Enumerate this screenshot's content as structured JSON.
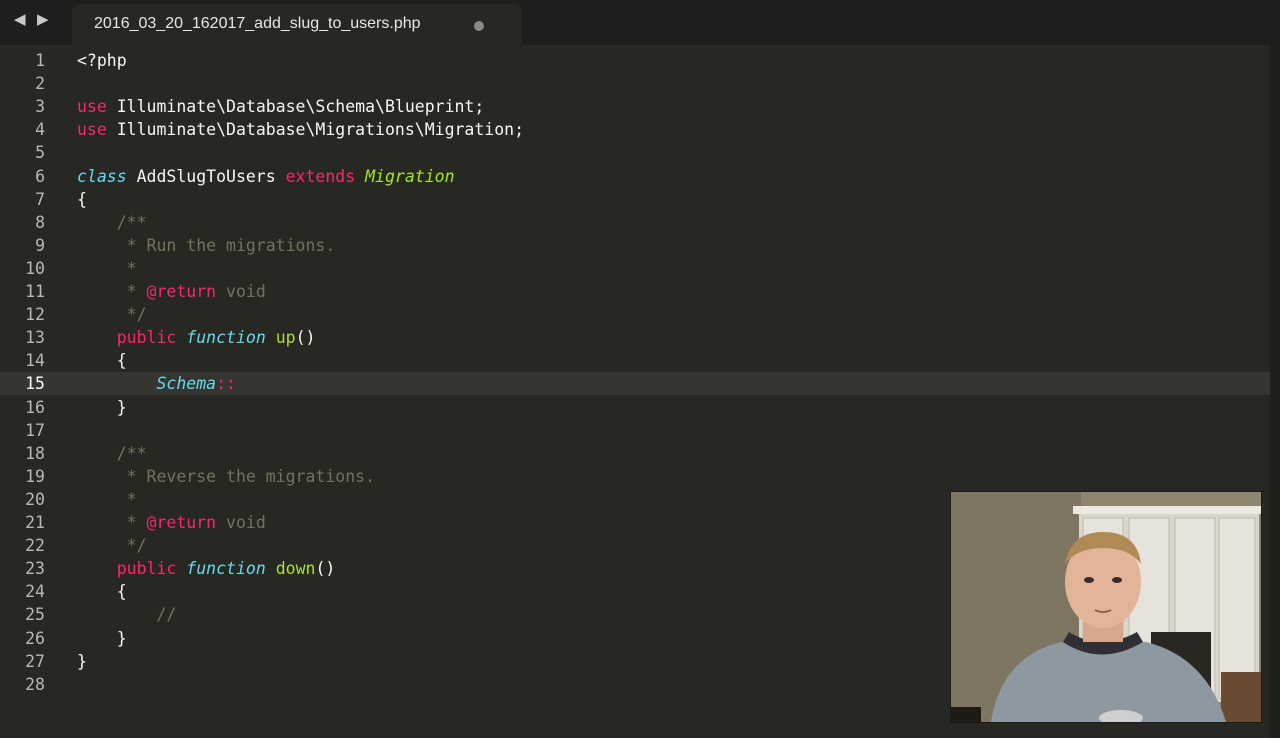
{
  "toolbar": {
    "back_icon": "left-arrow-icon",
    "forward_icon": "right-arrow-icon"
  },
  "tab": {
    "title": "2016_03_20_162017_add_slug_to_users.php",
    "modified_indicator": "dot-icon"
  },
  "editor": {
    "active_line": 15,
    "lines": [
      {
        "n": "1",
        "tokens": [
          {
            "t": "<?php",
            "c": "p"
          }
        ]
      },
      {
        "n": "2",
        "tokens": []
      },
      {
        "n": "3",
        "tokens": [
          {
            "t": "use",
            "c": "k"
          },
          {
            "t": " Illuminate\\Database\\Schema\\Blueprint;",
            "c": "p"
          }
        ]
      },
      {
        "n": "4",
        "tokens": [
          {
            "t": "use",
            "c": "k"
          },
          {
            "t": " Illuminate\\Database\\Migrations\\Migration;",
            "c": "p"
          }
        ]
      },
      {
        "n": "5",
        "tokens": []
      },
      {
        "n": "6",
        "tokens": [
          {
            "t": "class",
            "c": "s"
          },
          {
            "t": " AddSlugToUsers ",
            "c": "p"
          },
          {
            "t": "extends",
            "c": "k"
          },
          {
            "t": " ",
            "c": "p"
          },
          {
            "t": "Migration",
            "c": "ent"
          }
        ]
      },
      {
        "n": "7",
        "tokens": [
          {
            "t": "{",
            "c": "p"
          }
        ]
      },
      {
        "n": "8",
        "tokens": [
          {
            "t": "    /**",
            "c": "c"
          }
        ]
      },
      {
        "n": "9",
        "tokens": [
          {
            "t": "     * Run the migrations.",
            "c": "c"
          }
        ]
      },
      {
        "n": "10",
        "tokens": [
          {
            "t": "     *",
            "c": "c"
          }
        ]
      },
      {
        "n": "11",
        "tokens": [
          {
            "t": "     * ",
            "c": "c"
          },
          {
            "t": "@return",
            "c": "k"
          },
          {
            "t": " void",
            "c": "c"
          }
        ]
      },
      {
        "n": "12",
        "tokens": [
          {
            "t": "     */",
            "c": "c"
          }
        ]
      },
      {
        "n": "13",
        "tokens": [
          {
            "t": "    ",
            "c": "p"
          },
          {
            "t": "public",
            "c": "k"
          },
          {
            "t": " ",
            "c": "p"
          },
          {
            "t": "function",
            "c": "s"
          },
          {
            "t": " ",
            "c": "p"
          },
          {
            "t": "up",
            "c": "fn"
          },
          {
            "t": "()",
            "c": "p"
          }
        ]
      },
      {
        "n": "14",
        "tokens": [
          {
            "t": "    {",
            "c": "p"
          }
        ]
      },
      {
        "n": "15",
        "tokens": [
          {
            "t": "        ",
            "c": "p"
          },
          {
            "t": "Schema",
            "c": "s"
          },
          {
            "t": "::",
            "c": "k"
          }
        ]
      },
      {
        "n": "16",
        "tokens": [
          {
            "t": "    }",
            "c": "p"
          }
        ]
      },
      {
        "n": "17",
        "tokens": []
      },
      {
        "n": "18",
        "tokens": [
          {
            "t": "    /**",
            "c": "c"
          }
        ]
      },
      {
        "n": "19",
        "tokens": [
          {
            "t": "     * Reverse the migrations.",
            "c": "c"
          }
        ]
      },
      {
        "n": "20",
        "tokens": [
          {
            "t": "     *",
            "c": "c"
          }
        ]
      },
      {
        "n": "21",
        "tokens": [
          {
            "t": "     * ",
            "c": "c"
          },
          {
            "t": "@return",
            "c": "k"
          },
          {
            "t": " void",
            "c": "c"
          }
        ]
      },
      {
        "n": "22",
        "tokens": [
          {
            "t": "     */",
            "c": "c"
          }
        ]
      },
      {
        "n": "23",
        "tokens": [
          {
            "t": "    ",
            "c": "p"
          },
          {
            "t": "public",
            "c": "k"
          },
          {
            "t": " ",
            "c": "p"
          },
          {
            "t": "function",
            "c": "s"
          },
          {
            "t": " ",
            "c": "p"
          },
          {
            "t": "down",
            "c": "fn"
          },
          {
            "t": "()",
            "c": "p"
          }
        ]
      },
      {
        "n": "24",
        "tokens": [
          {
            "t": "    {",
            "c": "p"
          }
        ]
      },
      {
        "n": "25",
        "tokens": [
          {
            "t": "        //",
            "c": "c"
          }
        ]
      },
      {
        "n": "26",
        "tokens": [
          {
            "t": "    }",
            "c": "p"
          }
        ]
      },
      {
        "n": "27",
        "tokens": [
          {
            "t": "}",
            "c": "p"
          }
        ]
      },
      {
        "n": "28",
        "tokens": []
      }
    ]
  },
  "colors": {
    "background": "#272822",
    "keyword": "#f92672",
    "storage": "#66d9ef",
    "entity": "#a6e22e",
    "comment": "#75715e",
    "plain": "#f8f8f2"
  },
  "webcam": {
    "description_icon": "webcam-presenter"
  }
}
